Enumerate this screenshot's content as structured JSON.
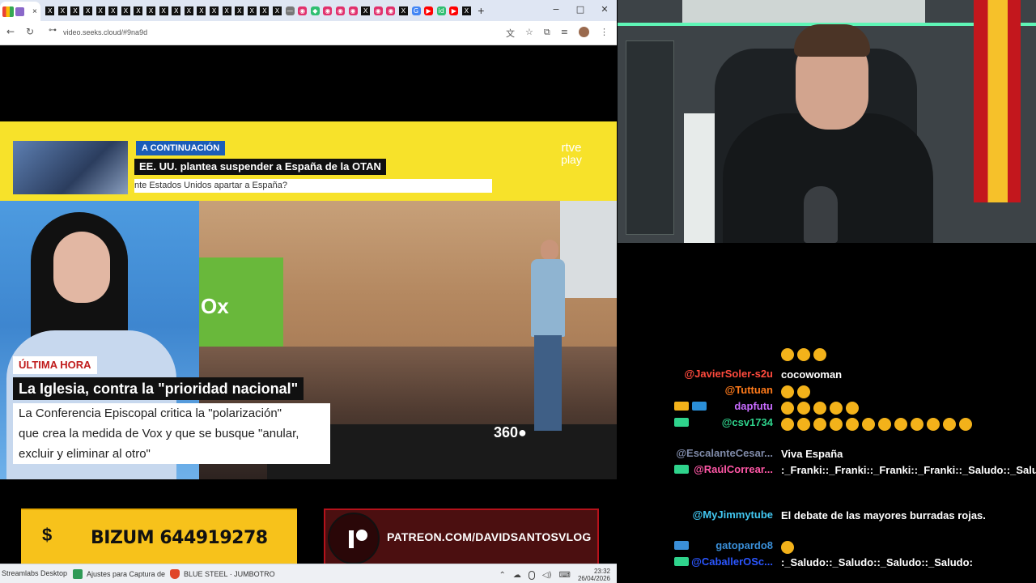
{
  "browser": {
    "active_tab_close": "×",
    "tab_icons": [
      "X",
      "X",
      "X",
      "X",
      "X",
      "X",
      "X",
      "X",
      "X",
      "X",
      "X",
      "X",
      "X",
      "X",
      "X",
      "X",
      "X",
      "X",
      "X",
      "—",
      "◉",
      "◆",
      "◉",
      "◉",
      "◉",
      "X",
      "◉",
      "◉",
      "X",
      "G",
      "▶",
      "id",
      "▶",
      "X"
    ],
    "new_tab": "+",
    "window_controls": {
      "minimize": "−",
      "maximize": "□",
      "close": "✕"
    },
    "back": "←",
    "reload": "↻",
    "url": "video.seeks.cloud/#9na9d",
    "right_icons": [
      "文",
      "☆",
      "⧉",
      "≡",
      "⋮"
    ]
  },
  "video": {
    "banner": {
      "next_tag": "A CONTINUACIÓN",
      "next_title": "EE. UU. plantea suspender a España de la OTAN",
      "next_sub": "nte Estados Unidos apartar a España?",
      "channel": "rtve",
      "channel_sub": "play"
    },
    "party_sign": "Ox",
    "logo360": "360●",
    "lower_third": {
      "tag": "ÚLTIMA HORA",
      "title": "La Iglesia, contra la \"prioridad nacional\"",
      "sub_lines": [
        "La Conferencia Episcopal critica la \"polarización\"",
        "que crea la medida de Vox y que se busque \"anular,",
        "excluir y eliminar al otro\""
      ]
    },
    "bizum": {
      "symbol": "$",
      "text": "BIZUM 644919278"
    },
    "patreon": {
      "text": "PATREON.COM/DAVIDSANTOSVLOG"
    }
  },
  "taskbar": {
    "items": [
      "Streamlabs Desktop",
      "Ajustes para Captura de",
      "BLUE STEEL · JUMBOTRO"
    ],
    "tray_icons": [
      "⌃",
      "☁",
      "🎙",
      "🔊",
      "◁)",
      "⌨"
    ],
    "time": "23:32",
    "date": "26/04/2026"
  },
  "chat": {
    "messages": [
      {
        "user": "",
        "color": "#ffffff",
        "text": "",
        "emotes": 3
      },
      {
        "user": "@JavierSoler-s2u",
        "color": "#ff4a3d",
        "text": "cocowoman",
        "emotes": 0
      },
      {
        "user": "@Tuttuan",
        "color": "#ff7a1a",
        "text": "",
        "emotes": 2
      },
      {
        "user": "dapfutu",
        "color": "#c86bff",
        "text": "",
        "emotes": 5
      },
      {
        "user": "@csv1734",
        "color": "#2fd38c",
        "text": "",
        "emotes": 12
      },
      {
        "user": "@EscalanteCesar...",
        "color": "#7f8aa8",
        "text": "Viva España",
        "emotes": 0
      },
      {
        "user": "@RaúlCorrear...",
        "color": "#ff57a6",
        "text": ":_Franki::_Franki::_Franki::_Franki::_Saludo::_Saludo::_Saludo::_Saludo::_Saludo:",
        "emotes": 0
      },
      {
        "user": "@MyJimmytube",
        "color": "#42c8f2",
        "text": "El debate de las mayores burradas rojas.",
        "emotes": 0
      },
      {
        "user": "gatopardo8",
        "color": "#3a8fd8",
        "text": "",
        "emotes": 1
      },
      {
        "user": "@CaballerOSc...",
        "color": "#2b56ff",
        "text": ":_Saludo::_Saludo::_Saludo::_Saludo:",
        "emotes": 0
      }
    ]
  },
  "colors": {
    "banner_yellow": "#f7e22a",
    "bizum_yellow": "#f7c21b",
    "patreon_red": "#b5121b",
    "tag_blue": "#1b5db8",
    "breaking_red": "#c01c1c"
  }
}
